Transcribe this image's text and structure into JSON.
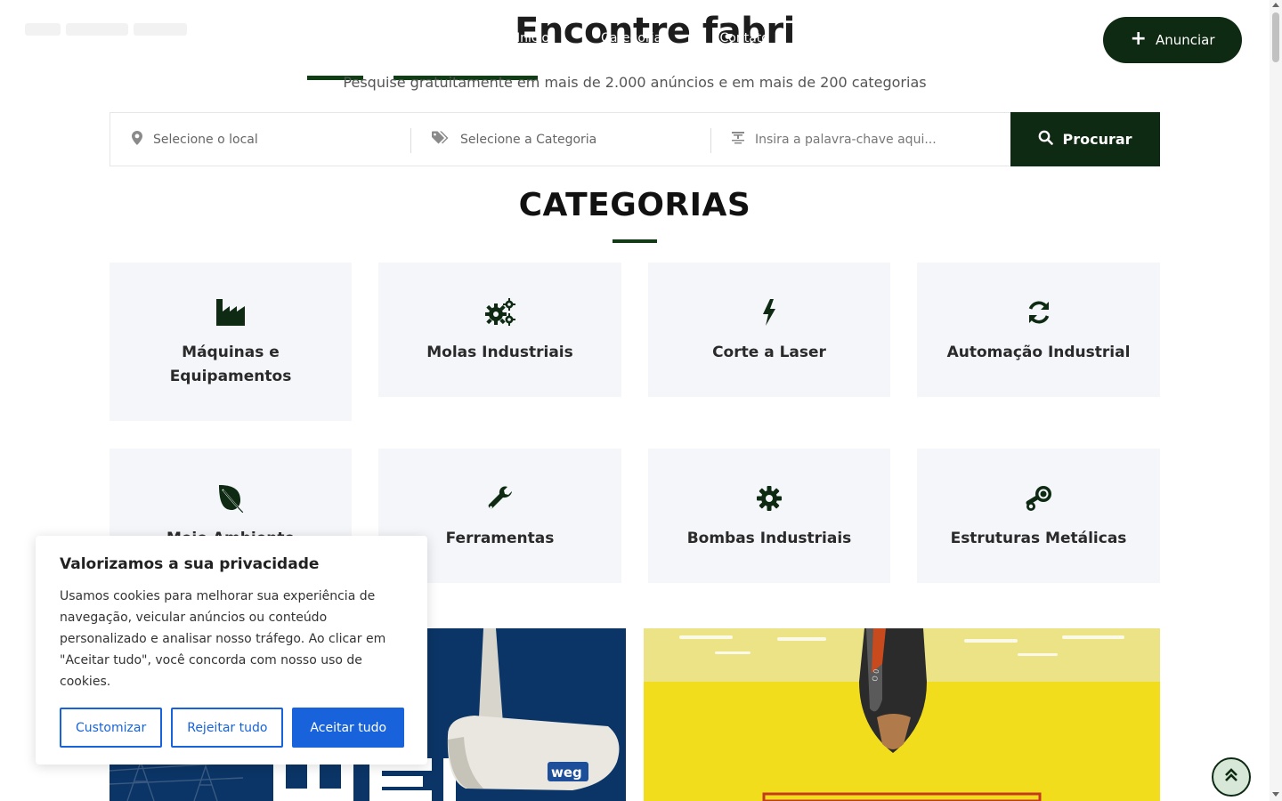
{
  "header": {
    "hero_title": "Encontre fabri",
    "nav": [
      "Início",
      "Categorias",
      "Contato"
    ],
    "anunciar_label": "Anunciar",
    "subtitle": "Pesquise gratuitamente em mais de 2.000 anúncios e em mais de 200 categorias"
  },
  "search": {
    "location_label": "Selecione o local",
    "category_label": "Selecione a Categoria",
    "keyword_placeholder": "Insira a palavra-chave aqui...",
    "button_label": "Procurar"
  },
  "categories": {
    "title": "CATEGORIAS",
    "items": [
      {
        "label": "Máquinas e Equipamentos",
        "icon": "factory-icon"
      },
      {
        "label": "Molas Industriais",
        "icon": "cogs-icon"
      },
      {
        "label": "Corte a Laser",
        "icon": "bolt-icon"
      },
      {
        "label": "Automação Industrial",
        "icon": "refresh-icon"
      },
      {
        "label": "Meio Ambiente",
        "icon": "leaf-icon"
      },
      {
        "label": "Ferramentas",
        "icon": "wrench-icon"
      },
      {
        "label": "Bombas Industriais",
        "icon": "gear-icon"
      },
      {
        "label": "Estruturas Metálicas",
        "icon": "steam-icon"
      }
    ]
  },
  "banners": {
    "weg_brand": "weg"
  },
  "cookie": {
    "title": "Valorizamos a sua privacidade",
    "text": "Usamos cookies para melhorar sua experiência de navegação, veicular anúncios ou conteúdo personalizado e analisar nosso tráfego. Ao clicar em \"Aceitar tudo\", você concorda com nosso uso de cookies.",
    "customize_label": "Customizar",
    "reject_label": "Rejeitar tudo",
    "accept_label": "Aceitar tudo"
  },
  "colors": {
    "brand_dark_green": "#0e2a12",
    "accent_green": "#0f3d14",
    "cookie_blue": "#1863dc",
    "card_bg": "#f4f6fa"
  }
}
